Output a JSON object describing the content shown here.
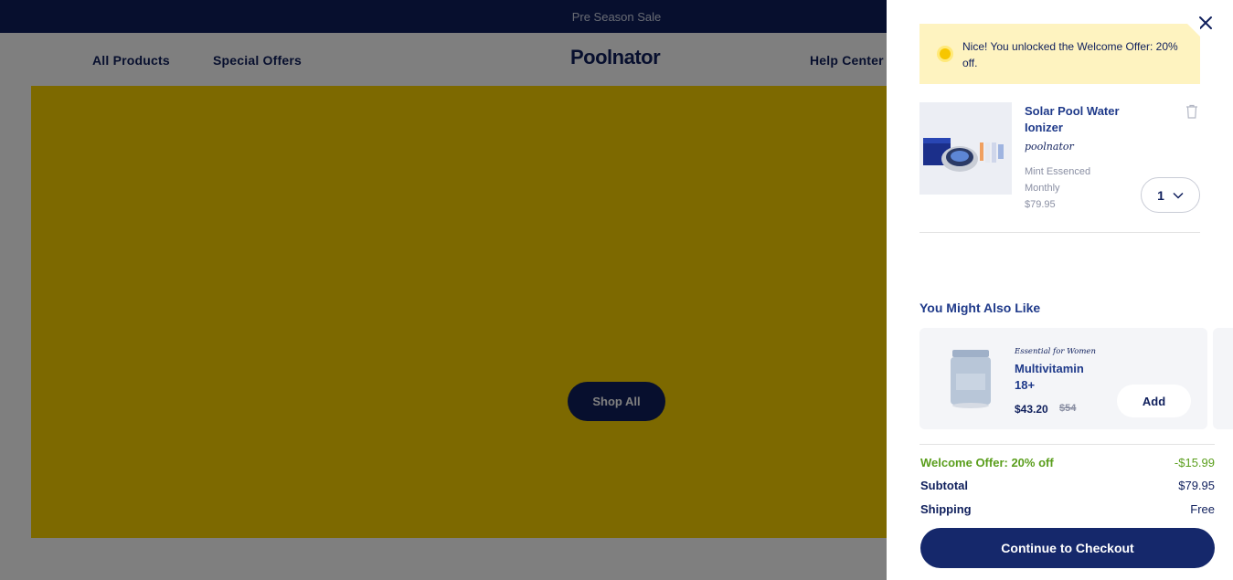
{
  "promo_bar": {
    "text": "Pre Season Sale"
  },
  "nav": {
    "all_products": "All Products",
    "special_offers": "Special Offers",
    "logo": "Poolnator",
    "help_center": "Help Center"
  },
  "hero": {
    "shop_all_label": "Shop All"
  },
  "cart": {
    "offer_banner": "Nice! You unlocked the Welcome Offer: 20% off.",
    "item": {
      "name": "Solar Pool Water Ionizer",
      "brand": "poolnator",
      "variant": "Mint Essenced",
      "frequency": "Monthly",
      "price": "$79.95",
      "quantity": "1"
    },
    "recommendations": {
      "title": "You Might Also Like",
      "product": {
        "tag": "Essential for Women",
        "name": "Multivitamin 18+",
        "price": "$43.20",
        "old_price": "$54",
        "add_label": "Add"
      }
    },
    "totals": {
      "discount_label": "Welcome Offer: 20% off",
      "discount_value": "-$15.99",
      "subtotal_label": "Subtotal",
      "subtotal_value": "$79.95",
      "shipping_label": "Shipping",
      "shipping_value": "Free"
    },
    "checkout_label": "Continue to Checkout"
  },
  "colors": {
    "navy": "#0f1f5c",
    "hero_yellow": "#fbd300",
    "banner_yellow": "#fef3c0",
    "offer_green": "#5a9e1c"
  },
  "icons": {
    "close": "close-icon",
    "sun": "sun-icon",
    "trash": "trash-icon",
    "chevron": "chevron-down-icon"
  }
}
